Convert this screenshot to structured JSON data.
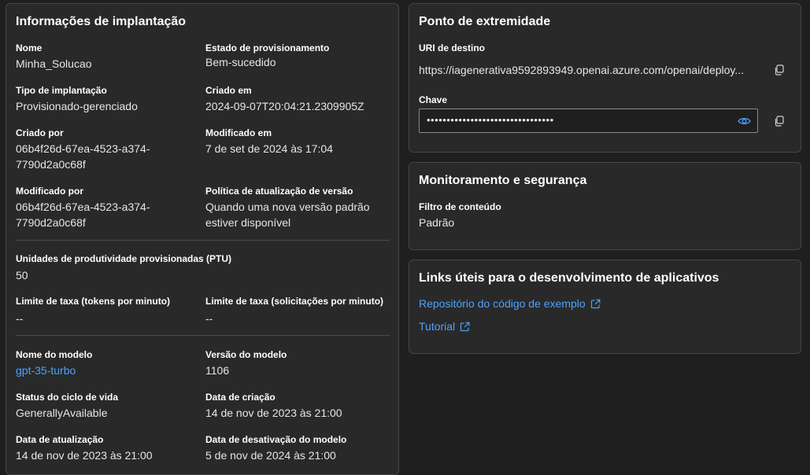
{
  "deployment": {
    "title": "Informações de implantação",
    "fields": [
      {
        "label": "Nome",
        "value": "Minha_Solucao"
      },
      {
        "label": "Estado de provisionamento",
        "value": "Bem-sucedido"
      },
      {
        "label": "Tipo de implantação",
        "value": "Provisionado-gerenciado"
      },
      {
        "label": "Criado em",
        "value": "2024-09-07T20:04:21.2309905Z"
      },
      {
        "label": "Criado por",
        "value": "06b4f26d-67ea-4523-a374-7790d2a0c68f"
      },
      {
        "label": "Modificado em",
        "value": "7 de set de 2024 às 17:04"
      },
      {
        "label": "Modificado por",
        "value": "06b4f26d-67ea-4523-a374-7790d2a0c68f"
      },
      {
        "label": "Política de atualização de versão",
        "value": "Quando uma nova versão padrão estiver disponível"
      },
      {
        "label": "Unidades de produtividade provisionadas (PTU)",
        "value": "50"
      },
      {
        "label": "Limite de taxa (tokens por minuto)",
        "value": "--"
      },
      {
        "label": "Limite de taxa (solicitações por minuto)",
        "value": "--"
      },
      {
        "label": "Nome do modelo",
        "value": "gpt-35-turbo"
      },
      {
        "label": "Versão do modelo",
        "value": "1106"
      },
      {
        "label": "Status do ciclo de vida",
        "value": "GenerallyAvailable"
      },
      {
        "label": "Data de criação",
        "value": "14 de nov de 2023 às 21:00"
      },
      {
        "label": "Data de atualização",
        "value": "14 de nov de 2023 às 21:00"
      },
      {
        "label": "Data de desativação do modelo",
        "value": "5 de nov de 2024 às 21:00"
      }
    ]
  },
  "endpoint": {
    "title": "Ponto de extremidade",
    "uri_label": "URI de destino",
    "uri_value": "https://iagenerativa9592893949.openai.azure.com/openai/deploy...",
    "key_label": "Chave",
    "key_value": "••••••••••••••••••••••••••••••••"
  },
  "monitoring": {
    "title": "Monitoramento e segurança",
    "filter_label": "Filtro de conteúdo",
    "filter_value": "Padrão"
  },
  "links": {
    "title": "Links úteis para o desenvolvimento de aplicativos",
    "items": [
      {
        "label": "Repositório do código de exemplo"
      },
      {
        "label": "Tutorial"
      }
    ]
  },
  "icons": {
    "copy": "copy-icon",
    "eye": "eye-icon",
    "external": "external-link-icon"
  },
  "colors": {
    "background": "#1f1f1f",
    "card": "#292929",
    "border": "#454545",
    "link": "#4ea1ff"
  }
}
